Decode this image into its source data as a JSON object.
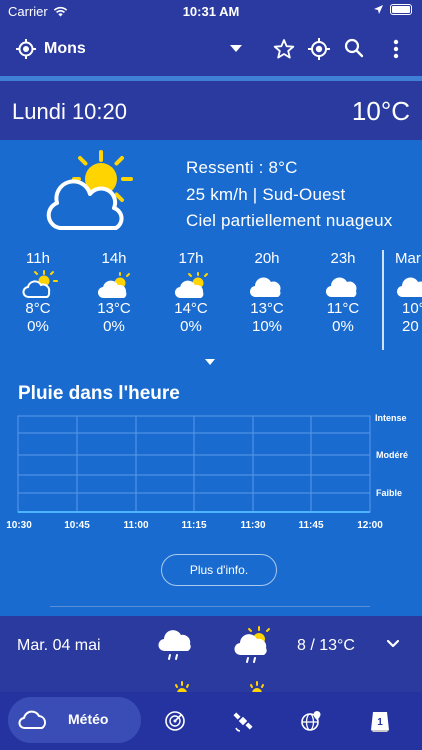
{
  "status_bar": {
    "carrier": "Carrier",
    "time": "10:31 AM"
  },
  "app_bar": {
    "city": "Mons"
  },
  "current": {
    "day_time": "Lundi 10:20",
    "temperature": "10°C",
    "feels_like": "Ressenti : 8°C",
    "wind": "25 km/h | Sud-Ouest",
    "condition": "Ciel partiellement nuageux"
  },
  "hourly": [
    {
      "hour": "11h",
      "temp": "8°C",
      "precip": "0%",
      "icon": "sun-cloud-icon"
    },
    {
      "hour": "14h",
      "temp": "13°C",
      "precip": "0%",
      "icon": "cloud-sun-icon"
    },
    {
      "hour": "17h",
      "temp": "14°C",
      "precip": "0%",
      "icon": "cloud-sun-icon"
    },
    {
      "hour": "20h",
      "temp": "13°C",
      "precip": "10%",
      "icon": "cloud-icon"
    },
    {
      "hour": "23h",
      "temp": "11°C",
      "precip": "0%",
      "icon": "cloud-icon"
    },
    {
      "hour": "Mar",
      "temp": "10°",
      "precip": "20",
      "icon": "cloud-icon"
    }
  ],
  "rain": {
    "title": "Pluie dans l'heure",
    "levels": [
      "Intense",
      "Modéré",
      "Faible"
    ],
    "times": [
      "10:30",
      "10:45",
      "11:00",
      "11:15",
      "11:30",
      "11:45",
      "12:00"
    ],
    "more_button": "Plus d'info."
  },
  "forecast": {
    "date": "Mar. 04 mai",
    "range": "8 / 13°C"
  },
  "tabs": {
    "active_label": "Météo"
  },
  "colors": {
    "header": "#2a3a9e",
    "main": "#1a6bd0",
    "accent": "#3f7fd6",
    "sun": "#ffd400"
  }
}
